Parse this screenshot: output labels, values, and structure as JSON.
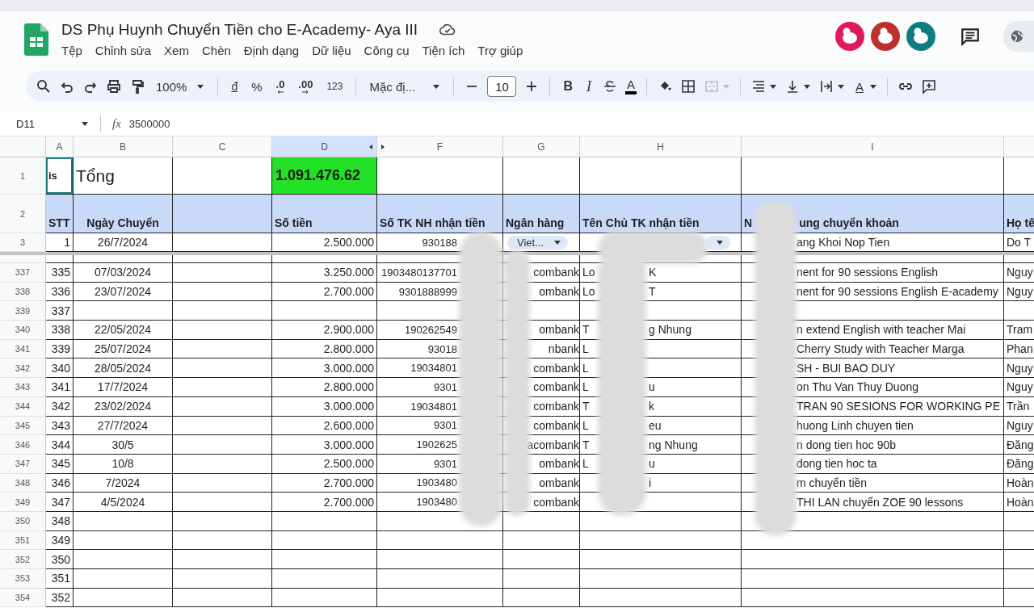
{
  "document": {
    "title": "DS Phụ Huynh Chuyển Tiền cho E-Academy- Aya III",
    "menu": [
      "Tệp",
      "Chỉnh sửa",
      "Xem",
      "Chèn",
      "Định dạng",
      "Dữ liệu",
      "Công cụ",
      "Tiện ích",
      "Trợ giúp"
    ]
  },
  "collaborators": [
    {
      "color": "#e0195f"
    },
    {
      "color": "#c0302a"
    },
    {
      "color": "#0e7c80"
    }
  ],
  "toolbar": {
    "zoom": "100%",
    "currency": "đ",
    "percent": "%",
    "decimal_decrease": ".0",
    "decimal_increase": ".00",
    "number_format": "123",
    "font": "Mặc đị...",
    "font_size": "10",
    "bold": "B",
    "italic": "I",
    "text_color": "A",
    "text_rotation": "A",
    "merge_disabled": true
  },
  "formula_bar": {
    "cell": "D11",
    "fx": "fx",
    "value": "3500000"
  },
  "sheet": {
    "columns": [
      {
        "label": "A",
        "selected": false,
        "hidden_after": false
      },
      {
        "label": "B",
        "selected": false,
        "hidden_after": false
      },
      {
        "label": "C",
        "selected": false,
        "hidden_after": false
      },
      {
        "label": "D",
        "selected": true,
        "hidden_after": true
      },
      {
        "label": "F",
        "selected": false,
        "hidden_after": false
      },
      {
        "label": "G",
        "selected": false,
        "hidden_after": false
      },
      {
        "label": "H",
        "selected": false,
        "hidden_after": false
      },
      {
        "label": "I",
        "selected": false,
        "hidden_after": false
      }
    ],
    "title_row": {
      "number": "1",
      "a": {
        "text": "is",
        "selected": true
      },
      "b": "Tổng",
      "d": "1.091.476.62"
    },
    "header_row": {
      "number": "2",
      "stt": "STT",
      "date": "Ngày Chuyển",
      "amount": "Số tiền",
      "account": "Số TK NH nhận tiền",
      "bank": "Ngân hàng",
      "holder": "Tên Chủ TK nhận tiền",
      "content_start": "N",
      "content_end": "ung chuyển khoản",
      "name": "Họ tê"
    },
    "frozen_row": {
      "number": "3",
      "stt": "1",
      "date": "26/7/2024",
      "amount": "2.500.000",
      "account": "930188",
      "bank": {
        "kind": "chip",
        "label": "Viet..."
      },
      "holder": {
        "kind": "chip"
      },
      "content": "ang Khoi Nop Tien",
      "name": "Do T"
    },
    "rows": [
      {
        "number": "337",
        "stt": "335",
        "date": "07/03/2024",
        "amount": "3.250.000",
        "account": "1903480137701",
        "bank": "combank",
        "holder": {
          "kind": "text",
          "start": "Lo",
          "end": "K"
        },
        "content": "nent for 90 sessions English",
        "name": "Nguy"
      },
      {
        "number": "338",
        "stt": "336",
        "date": "23/07/2024",
        "amount": "2.700.000",
        "account": "9301888999",
        "bank": "ombank",
        "holder": {
          "kind": "text",
          "start": "Lo",
          "end": "T"
        },
        "content": "nent for 90 sessions English E-academy",
        "name": "Nguy"
      },
      {
        "number": "339",
        "stt": "337"
      },
      {
        "number": "340",
        "stt": "338",
        "date": "22/05/2024",
        "amount": "2.900.000",
        "account": "190262549",
        "bank": "ombank",
        "holder": {
          "kind": "text",
          "start": "T",
          "end": "g Nhung"
        },
        "content": "n extend English with teacher Mai",
        "name": "Tram"
      },
      {
        "number": "341",
        "stt": "339",
        "date": "25/07/2024",
        "amount": "2.800.000",
        "account": "93018",
        "bank": "nbank",
        "holder": {
          "kind": "text",
          "start": "L"
        },
        "content": "Cherry Study with Teacher Marga",
        "name": "Phan"
      },
      {
        "number": "342",
        "stt": "340",
        "date": "28/05/2024",
        "amount": "3.000.000",
        "account": "19034801",
        "bank": "combank",
        "holder": {
          "kind": "text",
          "start": "L"
        },
        "content": "SH - BUI BAO DUY",
        "name": "Nguy"
      },
      {
        "number": "343",
        "stt": "341",
        "date": "17/7/2024",
        "amount": "2.800.000",
        "account": "9301",
        "bank": "combank",
        "holder": {
          "kind": "text",
          "start": "L",
          "end": "u"
        },
        "content": "on Thu Van Thuy Duong",
        "name": "Nguy"
      },
      {
        "number": "344",
        "stt": "342",
        "date": "23/02/2024",
        "amount": "3.000.000",
        "account": "19034801",
        "bank": "combank",
        "holder": {
          "kind": "text",
          "start": "T",
          "end": "k"
        },
        "content": "TRAN 90 SESIONS FOR WORKING PE",
        "name": "Trần"
      },
      {
        "number": "345",
        "stt": "343",
        "date": "27/7/2024",
        "amount": "2.600.000",
        "account": "9301",
        "bank": "combank",
        "holder": {
          "kind": "text",
          "start": "L",
          "end": "eu"
        },
        "content": "huong Linh chuyen tien",
        "name": "Nguy"
      },
      {
        "number": "346",
        "stt": "344",
        "date": "30/5",
        "amount": "3.000.000",
        "account": "1902625",
        "bank": "acombank",
        "holder": {
          "kind": "text",
          "start": "T",
          "end": "ng Nhung"
        },
        "content": "n dong tien hoc 90b",
        "name": "Đăng"
      },
      {
        "number": "347",
        "stt": "345",
        "date": "10/8",
        "amount": "2.500.000",
        "account": "9301",
        "bank": "ombank",
        "holder": {
          "kind": "text",
          "start": "L",
          "end": "u"
        },
        "content": "dong tien hoc ta",
        "name": "Đăng"
      },
      {
        "number": "348",
        "stt": "346",
        "date": "7/2024",
        "amount": "2.700.000",
        "account": "1903480",
        "bank": "ombank",
        "holder": {
          "kind": "text",
          "end": "i"
        },
        "content": "m chuyển tiền",
        "name": "Hoàn"
      },
      {
        "number": "349",
        "stt": "347",
        "date": "4/5/2024",
        "amount": "2.700.000",
        "account": "1903480",
        "bank": "combank",
        "content": "THI LAN chuyển ZOE 90 lessons",
        "name": "Hoàn"
      },
      {
        "number": "350",
        "stt": "348"
      },
      {
        "number": "351",
        "stt": "349"
      },
      {
        "number": "352",
        "stt": "350"
      },
      {
        "number": "353",
        "stt": "351"
      },
      {
        "number": "354",
        "stt": "352"
      }
    ]
  }
}
